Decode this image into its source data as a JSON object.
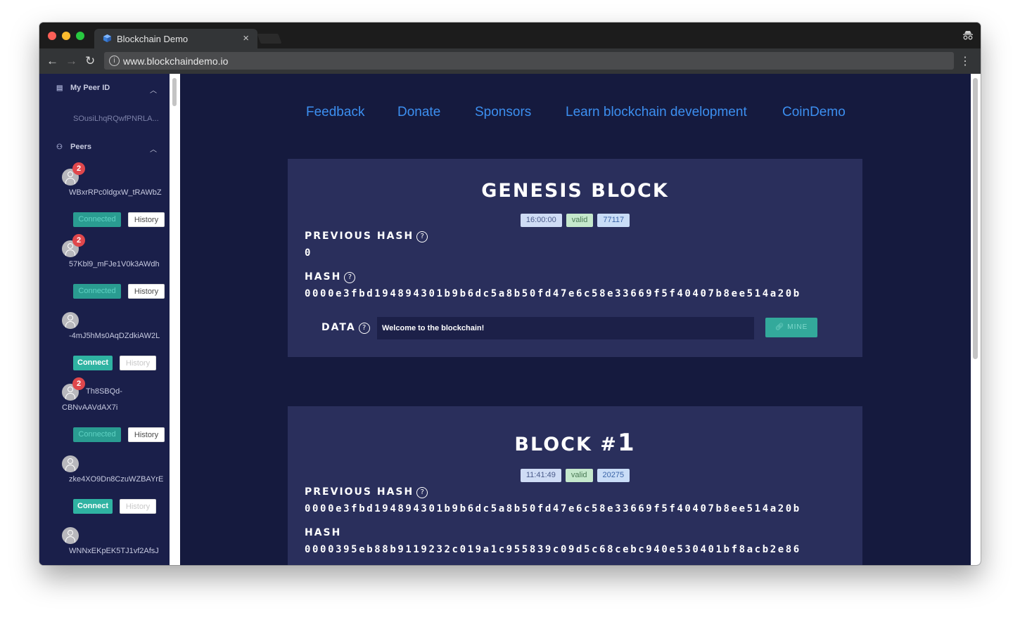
{
  "browser": {
    "tab_title": "Blockchain Demo",
    "url": "www.blockchaindemo.io"
  },
  "sidebar": {
    "my_peer_id": {
      "label": "My Peer ID",
      "value": "SOusiLhqRQwfPNRLA..."
    },
    "peers_label": "Peers",
    "peers": [
      {
        "name": "WBxrRPc0ldgxW_tRAWbZ",
        "badge": "2",
        "connect_label": "Connected",
        "history_label": "History"
      },
      {
        "name": "57Kbl9_mFJe1V0k3AWdh",
        "badge": "2",
        "connect_label": "Connected",
        "history_label": "History"
      },
      {
        "name": "-4mJ5hMs0AqDZdkiAW2L",
        "badge": "",
        "connect_label": "Connect",
        "history_label": "History"
      },
      {
        "name": "Th8SBQd-",
        "name2": "CBNvAAVdAX7i",
        "badge": "2",
        "connect_label": "Connected",
        "history_label": "History"
      },
      {
        "name": "zke4XO9Dn8CzuWZBAYrE",
        "badge": "",
        "connect_label": "Connect",
        "history_label": "History"
      },
      {
        "name": "WNNxEKpEK5TJ1vf2AfsJ",
        "badge": ""
      }
    ]
  },
  "topnav": [
    "Feedback",
    "Donate",
    "Sponsors",
    "Learn blockchain development",
    "CoinDemo"
  ],
  "blocks": [
    {
      "title": "GENESIS BLOCK",
      "time": "16:00:00",
      "status": "valid",
      "nonce": "77117",
      "prev_hash_label": "PREVIOUS HASH",
      "prev_hash": "0",
      "hash_label": "HASH",
      "hash": "0000e3fbd194894301b9b6dc5a8b50fd47e6c58e33669f5f40407b8ee514a20b",
      "data_label": "DATA",
      "data": "Welcome to the blockchain!",
      "mine_label": "MINE"
    },
    {
      "title_prefix": "BLOCK #",
      "title_num": "1",
      "time": "11:41:49",
      "status": "valid",
      "nonce": "20275",
      "prev_hash_label": "PREVIOUS HASH",
      "prev_hash": "0000e3fbd194894301b9b6dc5a8b50fd47e6c58e33669f5f40407b8ee514a20b",
      "hash_label": "HASH",
      "hash": "0000395eb88b9119232c019a1c955839c09d5c68cebc940e530401bf8acb2e86"
    }
  ]
}
